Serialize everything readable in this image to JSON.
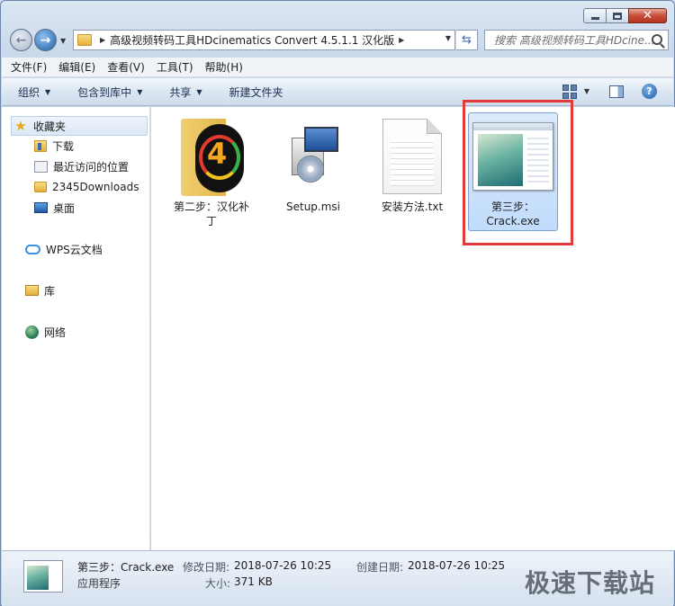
{
  "window": {
    "address": "高级视频转码工具HDcinematics Convert 4.5.1.1 汉化版",
    "search_placeholder": "搜索 高级视频转码工具HDcine..."
  },
  "menu": [
    "文件(F)",
    "编辑(E)",
    "查看(V)",
    "工具(T)",
    "帮助(H)"
  ],
  "toolbar": {
    "organize": "组织",
    "include_in_library": "包含到库中",
    "share": "共享",
    "new_folder": "新建文件夹"
  },
  "sidebar": {
    "favorites": "收藏夹",
    "downloads": "下载",
    "recent": "最近访问的位置",
    "folder_2345": "2345Downloads",
    "desktop": "桌面",
    "wps": "WPS云文档",
    "library": "库",
    "network": "网络"
  },
  "files": [
    {
      "name": "第二步：汉化补丁",
      "icon": "folder-icon"
    },
    {
      "name": "Setup.msi",
      "icon": "installer-icon"
    },
    {
      "name": "安装方法.txt",
      "icon": "text-file-icon"
    },
    {
      "name": "第三步：Crack.exe",
      "icon": "exe-icon",
      "selected": true
    }
  ],
  "details": {
    "name": "第三步：Crack.exe",
    "type": "应用程序",
    "modified_label": "修改日期:",
    "modified_value": "2018-07-26 10:25",
    "created_label": "创建日期:",
    "created_value": "2018-07-26 10:25",
    "size_label": "大小:",
    "size_value": "371 KB"
  },
  "watermark": "极速下载站",
  "colors": {
    "highlight": "#e03a3a",
    "selection": "#c1dcfc"
  }
}
